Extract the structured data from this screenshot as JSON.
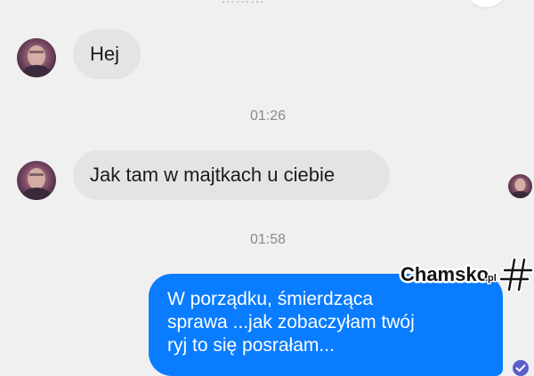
{
  "header": {
    "cut_title": "………",
    "cut_button_icon": "circle-button"
  },
  "messages": [
    {
      "direction": "incoming",
      "text": "Hej"
    },
    {
      "timestamp": "01:26"
    },
    {
      "direction": "incoming",
      "text": "Jak tam w majtkach u ciebie"
    },
    {
      "timestamp": "01:58"
    },
    {
      "direction": "outgoing",
      "lines": [
        "W porządku, śmierdząca",
        "sprawa ...jak zobaczyłam twój",
        "ryj to się posrałam..."
      ]
    }
  ],
  "watermark": {
    "text": "Chamsko",
    "suffix": ".pl"
  },
  "colors": {
    "background": "#f0f0f0",
    "incoming_bubble": "#e4e4e6",
    "outgoing_bubble": "#0a7cff",
    "read_receipt": "#5b5ec9",
    "timestamp": "#8a8a8a"
  },
  "icons": {
    "contact_avatar": "avatar",
    "seen_avatar": "avatar",
    "read_receipt": "check-icon",
    "watermark_logo": "hash-icon"
  }
}
